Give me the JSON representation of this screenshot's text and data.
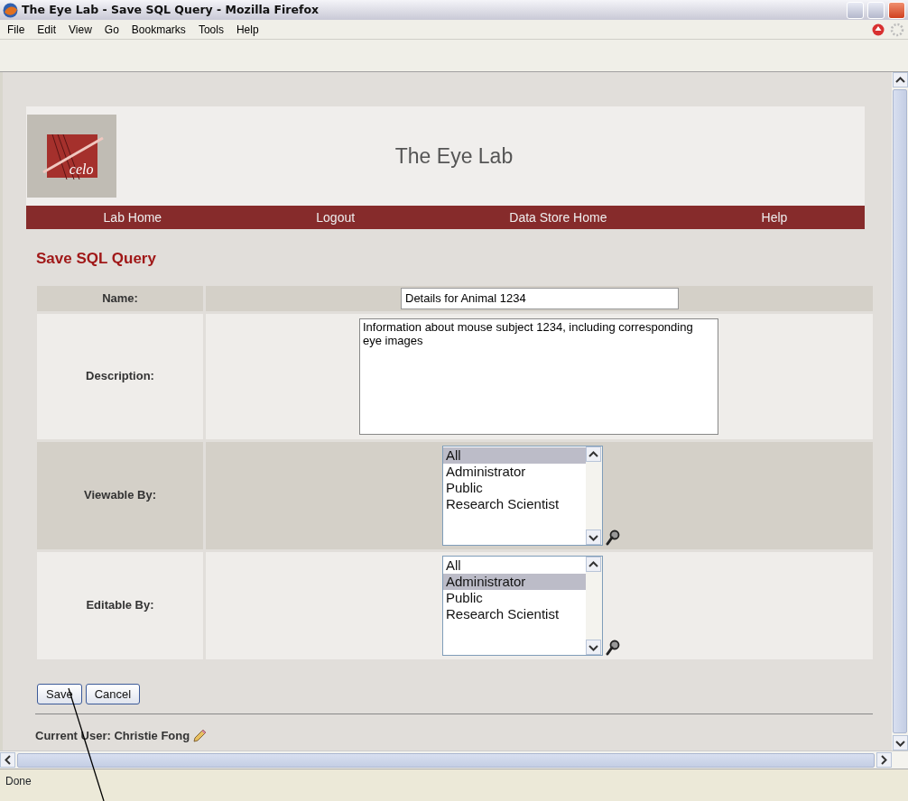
{
  "window": {
    "title": "The Eye Lab - Save SQL Query - Mozilla Firefox"
  },
  "menu": [
    "File",
    "Edit",
    "View",
    "Go",
    "Bookmarks",
    "Tools",
    "Help"
  ],
  "site": {
    "logo_text": "celo",
    "title": "The Eye Lab"
  },
  "nav": [
    "Lab Home",
    "Logout",
    "Data Store Home",
    "Help"
  ],
  "heading": "Save SQL Query",
  "form": [
    {
      "kind": "text",
      "label": "Name:",
      "value": "Details for Animal 1234"
    },
    {
      "kind": "textarea",
      "label": "Description:",
      "value": "Information about mouse subject 1234, including corresponding eye images"
    },
    {
      "kind": "list",
      "label": "Viewable By:",
      "options": [
        {
          "label": "All",
          "selected": true
        },
        {
          "label": "Administrator",
          "selected": false
        },
        {
          "label": "Public",
          "selected": false
        },
        {
          "label": "Research Scientist",
          "selected": false
        }
      ]
    },
    {
      "kind": "list",
      "label": "Editable By:",
      "options": [
        {
          "label": "All",
          "selected": false
        },
        {
          "label": "Administrator",
          "selected": true
        },
        {
          "label": "Public",
          "selected": false
        },
        {
          "label": "Research Scientist",
          "selected": false
        }
      ]
    }
  ],
  "buttons": [
    "Save",
    "Cancel"
  ],
  "current_user": "Current User: Christie Fong",
  "status_bar": "Done"
}
